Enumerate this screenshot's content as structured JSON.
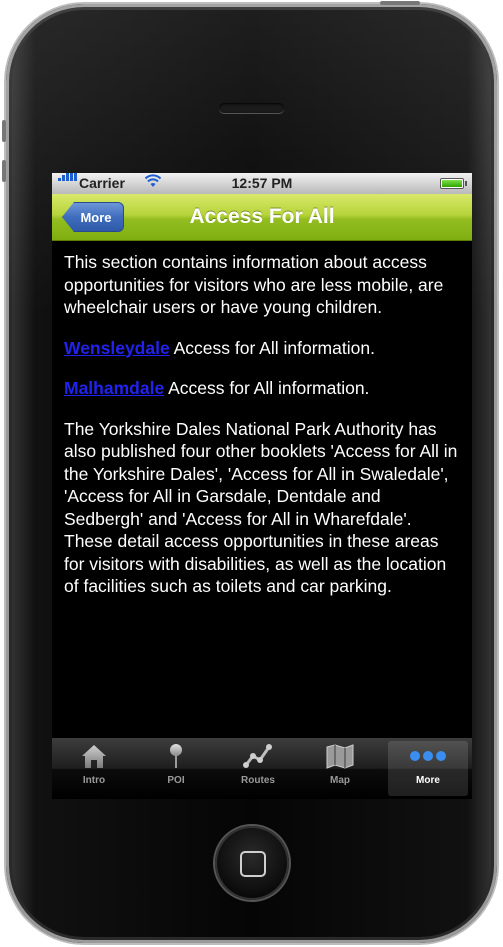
{
  "status_bar": {
    "carrier": "Carrier",
    "time": "12:57 PM"
  },
  "nav_bar": {
    "back_label": "More",
    "title": "Access For All"
  },
  "content": {
    "intro": "This section contains information about access opportunities for visitors who are less mobile, are wheelchair users or have young children.",
    "wensleydale_link": "Wensleydale",
    "wensleydale_text": " Access for All information.",
    "malhamdale_link": "Malhamdale",
    "malhamdale_text": " Access for All information.",
    "booklets": "The Yorkshire Dales National Park Authority has also published four other booklets 'Access for All in the Yorkshire Dales', 'Access for All in Swaledale', 'Access for All in Garsdale, Dentdale and Sedbergh' and 'Access for All in Wharefdale'. These detail access opportunities in these areas for visitors with disabilities, as well as the location of facilities such as toilets and car parking."
  },
  "tab_bar": {
    "items": [
      {
        "label": "Intro",
        "icon": "house-icon"
      },
      {
        "label": "POI",
        "icon": "pin-icon"
      },
      {
        "label": "Routes",
        "icon": "route-icon"
      },
      {
        "label": "Map",
        "icon": "map-icon"
      },
      {
        "label": "More",
        "icon": "more-dots-icon"
      }
    ],
    "active_index": 4
  },
  "colors": {
    "nav_bar_green": "#9cc42a",
    "back_button_blue": "#3f6dbd",
    "link_blue": "#2222ee",
    "active_tab_blue": "#3a8ef2"
  }
}
